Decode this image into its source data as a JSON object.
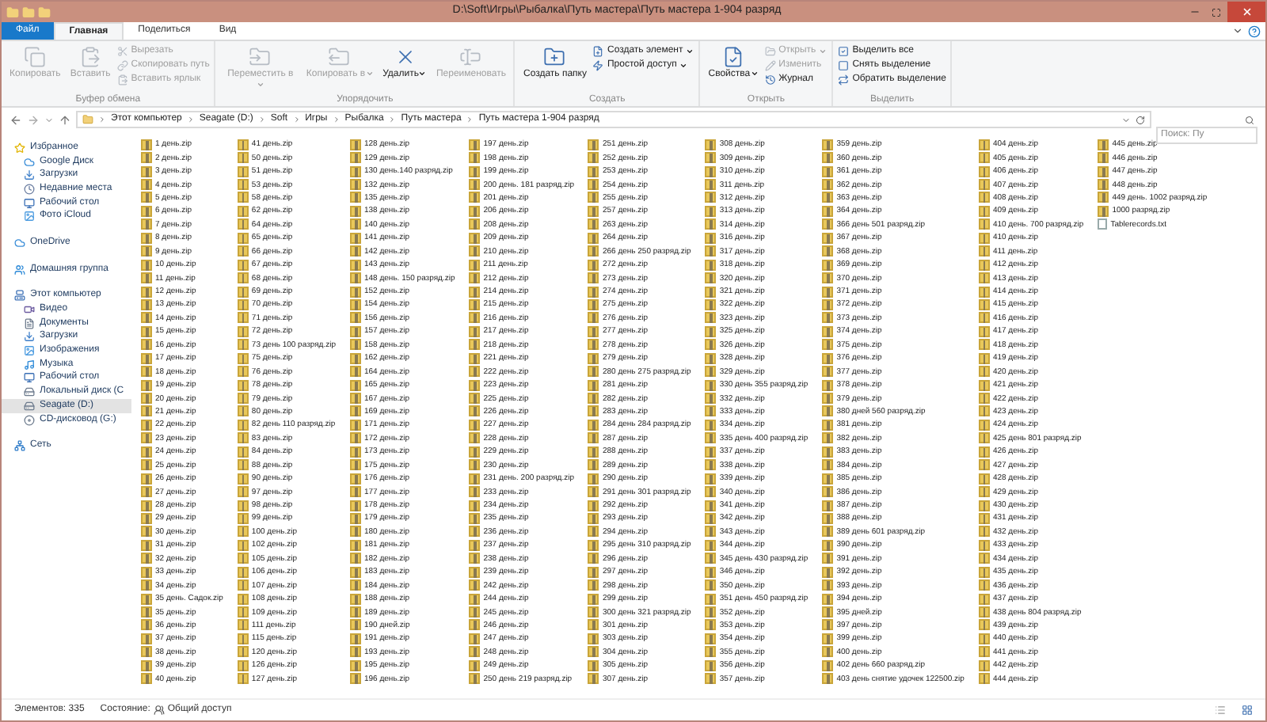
{
  "window": {
    "title": "D:\\Soft\\Игры\\Рыбалка\\Путь мастера\\Путь мастера 1-904 разряд"
  },
  "ribbon_tabs": [
    {
      "label": "Файл",
      "kind": "file",
      "selected": false
    },
    {
      "label": "Главная",
      "kind": "tab",
      "selected": true
    },
    {
      "label": "Поделиться",
      "kind": "tab",
      "selected": false
    },
    {
      "label": "Вид",
      "kind": "tab",
      "selected": false
    }
  ],
  "ribbon_groups": [
    {
      "label": "Буфер обмена",
      "buttons": [
        {
          "label": "Копировать",
          "kind": "large",
          "disabled": true,
          "menu": false
        },
        {
          "label": "Вставить",
          "kind": "large",
          "disabled": true,
          "menu": false
        },
        {
          "label": "Вырезать",
          "kind": "small",
          "disabled": true,
          "menu": false
        },
        {
          "label": "Скопировать путь",
          "kind": "small",
          "disabled": true,
          "menu": false
        },
        {
          "label": "Вставить ярлык",
          "kind": "small",
          "disabled": true,
          "menu": false
        }
      ]
    },
    {
      "label": "Упорядочить",
      "buttons": [
        {
          "label": "Переместить в",
          "kind": "large",
          "disabled": true,
          "menu": true
        },
        {
          "label": "Копировать в",
          "kind": "large",
          "disabled": true,
          "menu": true
        },
        {
          "label": "Удалить",
          "kind": "large",
          "disabled": false,
          "menu": true
        },
        {
          "label": "Переименовать",
          "kind": "large",
          "disabled": true,
          "menu": false
        }
      ]
    },
    {
      "label": "Создать",
      "buttons": [
        {
          "label": "Создать папку",
          "kind": "large",
          "disabled": false,
          "menu": false
        },
        {
          "label": "Создать элемент",
          "kind": "small",
          "disabled": false,
          "menu": true
        },
        {
          "label": "Простой доступ",
          "kind": "small",
          "disabled": false,
          "menu": true
        }
      ]
    },
    {
      "label": "Открыть",
      "buttons": [
        {
          "label": "Свойства",
          "kind": "large",
          "disabled": false,
          "menu": true
        },
        {
          "label": "Открыть",
          "kind": "small",
          "disabled": true,
          "menu": true
        },
        {
          "label": "Изменить",
          "kind": "small",
          "disabled": true,
          "menu": false
        },
        {
          "label": "Журнал",
          "kind": "small",
          "disabled": false,
          "menu": false
        }
      ]
    },
    {
      "label": "Выделить",
      "buttons": [
        {
          "label": "Выделить все",
          "kind": "small",
          "disabled": false,
          "menu": false
        },
        {
          "label": "Снять выделение",
          "kind": "small",
          "disabled": false,
          "menu": false
        },
        {
          "label": "Обратить выделение",
          "kind": "small",
          "disabled": false,
          "menu": false
        }
      ]
    }
  ],
  "address_bar": {
    "crumbs": [
      "Этот компьютер",
      "Seagate (D:)",
      "Soft",
      "Игры",
      "Рыбалка",
      "Путь мастера",
      "Путь мастера 1-904 разряд"
    ]
  },
  "search": {
    "placeholder": "Поиск: Пу"
  },
  "sidebar": [
    {
      "label": "Избранное",
      "selected": false,
      "children": [
        {
          "label": "Google Диск",
          "selected": false
        },
        {
          "label": "Загрузки",
          "selected": false
        },
        {
          "label": "Недавние места",
          "selected": false
        },
        {
          "label": "Рабочий стол",
          "selected": false
        },
        {
          "label": "Фото iCloud",
          "selected": false
        }
      ]
    },
    {
      "label": "OneDrive",
      "selected": false
    },
    {
      "label": "Домашняя группа",
      "selected": false
    },
    {
      "label": "Этот компьютер",
      "selected": false,
      "children": [
        {
          "label": "Видео",
          "selected": false
        },
        {
          "label": "Документы",
          "selected": false
        },
        {
          "label": "Загрузки",
          "selected": false
        },
        {
          "label": "Изображения",
          "selected": false
        },
        {
          "label": "Музыка",
          "selected": false
        },
        {
          "label": "Рабочий стол",
          "selected": false
        },
        {
          "label": "Локальный диск (C",
          "selected": false
        },
        {
          "label": "Seagate (D:)",
          "selected": true
        },
        {
          "label": "CD-дисковод (G:)",
          "selected": false
        }
      ]
    },
    {
      "label": "Сеть",
      "selected": false
    }
  ],
  "files": [
    {
      "name": "1 день.zip",
      "kind": "zip"
    },
    {
      "name": "2 день.zip",
      "kind": "zip"
    },
    {
      "name": "3 день.zip",
      "kind": "zip"
    },
    {
      "name": "4 день.zip",
      "kind": "zip"
    },
    {
      "name": "5 день.zip",
      "kind": "zip"
    },
    {
      "name": "6 день.zip",
      "kind": "zip"
    },
    {
      "name": "7 день.zip",
      "kind": "zip"
    },
    {
      "name": "8 день.zip",
      "kind": "zip"
    },
    {
      "name": "9 день.zip",
      "kind": "zip"
    },
    {
      "name": "10 день.zip",
      "kind": "zip"
    },
    {
      "name": "11 день.zip",
      "kind": "zip"
    },
    {
      "name": "12 день.zip",
      "kind": "zip"
    },
    {
      "name": "13 день.zip",
      "kind": "zip"
    },
    {
      "name": "14 день.zip",
      "kind": "zip"
    },
    {
      "name": "15 день.zip",
      "kind": "zip"
    },
    {
      "name": "16 день.zip",
      "kind": "zip"
    },
    {
      "name": "17 день.zip",
      "kind": "zip"
    },
    {
      "name": "18 день.zip",
      "kind": "zip"
    },
    {
      "name": "19 день.zip",
      "kind": "zip"
    },
    {
      "name": "20 день.zip",
      "kind": "zip"
    },
    {
      "name": "21 день.zip",
      "kind": "zip"
    },
    {
      "name": "22 день.zip",
      "kind": "zip"
    },
    {
      "name": "23 день.zip",
      "kind": "zip"
    },
    {
      "name": "24 день.zip",
      "kind": "zip"
    },
    {
      "name": "25 день.zip",
      "kind": "zip"
    },
    {
      "name": "26 день.zip",
      "kind": "zip"
    },
    {
      "name": "27 день.zip",
      "kind": "zip"
    },
    {
      "name": "28 день.zip",
      "kind": "zip"
    },
    {
      "name": "29 день.zip",
      "kind": "zip"
    },
    {
      "name": "30 день.zip",
      "kind": "zip"
    },
    {
      "name": "31 день.zip",
      "kind": "zip"
    },
    {
      "name": "32 день.zip",
      "kind": "zip"
    },
    {
      "name": "33 день.zip",
      "kind": "zip"
    },
    {
      "name": "34 день.zip",
      "kind": "zip"
    },
    {
      "name": "35 день. Садок.zip",
      "kind": "zip"
    },
    {
      "name": "35 день.zip",
      "kind": "zip"
    },
    {
      "name": "36 день.zip",
      "kind": "zip"
    },
    {
      "name": "37 день.zip",
      "kind": "zip"
    },
    {
      "name": "38 день.zip",
      "kind": "zip"
    },
    {
      "name": "39 день.zip",
      "kind": "zip"
    },
    {
      "name": "40 день.zip",
      "kind": "zip"
    },
    {
      "name": "41 день.zip",
      "kind": "zip"
    },
    {
      "name": "50 день.zip",
      "kind": "zip"
    },
    {
      "name": "51 день.zip",
      "kind": "zip"
    },
    {
      "name": "53 день.zip",
      "kind": "zip"
    },
    {
      "name": "58 день.zip",
      "kind": "zip"
    },
    {
      "name": "62 день.zip",
      "kind": "zip"
    },
    {
      "name": "64 день.zip",
      "kind": "zip"
    },
    {
      "name": "65 день.zip",
      "kind": "zip"
    },
    {
      "name": "66 день.zip",
      "kind": "zip"
    },
    {
      "name": "67 день.zip",
      "kind": "zip"
    },
    {
      "name": "68 день.zip",
      "kind": "zip"
    },
    {
      "name": "69 день.zip",
      "kind": "zip"
    },
    {
      "name": "70 день.zip",
      "kind": "zip"
    },
    {
      "name": "71 день.zip",
      "kind": "zip"
    },
    {
      "name": "72 день.zip",
      "kind": "zip"
    },
    {
      "name": "73 день 100 разряд.zip",
      "kind": "zip"
    },
    {
      "name": "75 день.zip",
      "kind": "zip"
    },
    {
      "name": "76 день.zip",
      "kind": "zip"
    },
    {
      "name": "78 день.zip",
      "kind": "zip"
    },
    {
      "name": "79 день.zip",
      "kind": "zip"
    },
    {
      "name": "80 день.zip",
      "kind": "zip"
    },
    {
      "name": "82 день 110 разряд.zip",
      "kind": "zip"
    },
    {
      "name": "83 день.zip",
      "kind": "zip"
    },
    {
      "name": "84 день.zip",
      "kind": "zip"
    },
    {
      "name": "88 день.zip",
      "kind": "zip"
    },
    {
      "name": "90 день.zip",
      "kind": "zip"
    },
    {
      "name": "97 день.zip",
      "kind": "zip"
    },
    {
      "name": "98 день.zip",
      "kind": "zip"
    },
    {
      "name": "99 день.zip",
      "kind": "zip"
    },
    {
      "name": "100 день.zip",
      "kind": "zip"
    },
    {
      "name": "102 день.zip",
      "kind": "zip"
    },
    {
      "name": "105 день.zip",
      "kind": "zip"
    },
    {
      "name": "106 день.zip",
      "kind": "zip"
    },
    {
      "name": "107 день.zip",
      "kind": "zip"
    },
    {
      "name": "108 день.zip",
      "kind": "zip"
    },
    {
      "name": "109 день.zip",
      "kind": "zip"
    },
    {
      "name": "111 день.zip",
      "kind": "zip"
    },
    {
      "name": "115 день.zip",
      "kind": "zip"
    },
    {
      "name": "120 день.zip",
      "kind": "zip"
    },
    {
      "name": "126 день.zip",
      "kind": "zip"
    },
    {
      "name": "127 день.zip",
      "kind": "zip"
    },
    {
      "name": "128 день.zip",
      "kind": "zip"
    },
    {
      "name": "129 день.zip",
      "kind": "zip"
    },
    {
      "name": "130 день.140 разряд.zip",
      "kind": "zip"
    },
    {
      "name": "132 день.zip",
      "kind": "zip"
    },
    {
      "name": "135 день.zip",
      "kind": "zip"
    },
    {
      "name": "138 день.zip",
      "kind": "zip"
    },
    {
      "name": "140 день.zip",
      "kind": "zip"
    },
    {
      "name": "141 день.zip",
      "kind": "zip"
    },
    {
      "name": "142 день.zip",
      "kind": "zip"
    },
    {
      "name": "143 день.zip",
      "kind": "zip"
    },
    {
      "name": "148 день. 150 разряд.zip",
      "kind": "zip"
    },
    {
      "name": "152 день.zip",
      "kind": "zip"
    },
    {
      "name": "154 день.zip",
      "kind": "zip"
    },
    {
      "name": "156 день.zip",
      "kind": "zip"
    },
    {
      "name": "157 день.zip",
      "kind": "zip"
    },
    {
      "name": "158 день.zip",
      "kind": "zip"
    },
    {
      "name": "162 день.zip",
      "kind": "zip"
    },
    {
      "name": "164 день.zip",
      "kind": "zip"
    },
    {
      "name": "165 день.zip",
      "kind": "zip"
    },
    {
      "name": "167 день.zip",
      "kind": "zip"
    },
    {
      "name": "169 день.zip",
      "kind": "zip"
    },
    {
      "name": "171 день.zip",
      "kind": "zip"
    },
    {
      "name": "172 день.zip",
      "kind": "zip"
    },
    {
      "name": "173 день.zip",
      "kind": "zip"
    },
    {
      "name": "175 день.zip",
      "kind": "zip"
    },
    {
      "name": "176 день.zip",
      "kind": "zip"
    },
    {
      "name": "177 день.zip",
      "kind": "zip"
    },
    {
      "name": "178 день.zip",
      "kind": "zip"
    },
    {
      "name": "179 день.zip",
      "kind": "zip"
    },
    {
      "name": "180 день.zip",
      "kind": "zip"
    },
    {
      "name": "181 день.zip",
      "kind": "zip"
    },
    {
      "name": "182 день.zip",
      "kind": "zip"
    },
    {
      "name": "183 день.zip",
      "kind": "zip"
    },
    {
      "name": "184 день.zip",
      "kind": "zip"
    },
    {
      "name": "188 день.zip",
      "kind": "zip"
    },
    {
      "name": "189 день.zip",
      "kind": "zip"
    },
    {
      "name": "190 дней.zip",
      "kind": "zip"
    },
    {
      "name": "191 день.zip",
      "kind": "zip"
    },
    {
      "name": "193 день.zip",
      "kind": "zip"
    },
    {
      "name": "195 день.zip",
      "kind": "zip"
    },
    {
      "name": "196 день.zip",
      "kind": "zip"
    },
    {
      "name": "197 день.zip",
      "kind": "zip"
    },
    {
      "name": "198 день.zip",
      "kind": "zip"
    },
    {
      "name": "199 день.zip",
      "kind": "zip"
    },
    {
      "name": "200 день. 181 разряд.zip",
      "kind": "zip"
    },
    {
      "name": "201 день.zip",
      "kind": "zip"
    },
    {
      "name": "206 день.zip",
      "kind": "zip"
    },
    {
      "name": "208 день.zip",
      "kind": "zip"
    },
    {
      "name": "209 день.zip",
      "kind": "zip"
    },
    {
      "name": "210 день.zip",
      "kind": "zip"
    },
    {
      "name": "211 день.zip",
      "kind": "zip"
    },
    {
      "name": "212 день.zip",
      "kind": "zip"
    },
    {
      "name": "214 день.zip",
      "kind": "zip"
    },
    {
      "name": "215 день.zip",
      "kind": "zip"
    },
    {
      "name": "216 день.zip",
      "kind": "zip"
    },
    {
      "name": "217 день.zip",
      "kind": "zip"
    },
    {
      "name": "218 день.zip",
      "kind": "zip"
    },
    {
      "name": "221 день.zip",
      "kind": "zip"
    },
    {
      "name": "222 день.zip",
      "kind": "zip"
    },
    {
      "name": "223 день.zip",
      "kind": "zip"
    },
    {
      "name": "225 день.zip",
      "kind": "zip"
    },
    {
      "name": "226 день.zip",
      "kind": "zip"
    },
    {
      "name": "227 день.zip",
      "kind": "zip"
    },
    {
      "name": "228 день.zip",
      "kind": "zip"
    },
    {
      "name": "229 день.zip",
      "kind": "zip"
    },
    {
      "name": "230 день.zip",
      "kind": "zip"
    },
    {
      "name": "231 день. 200 разряд.zip",
      "kind": "zip"
    },
    {
      "name": "233 день.zip",
      "kind": "zip"
    },
    {
      "name": "234 день.zip",
      "kind": "zip"
    },
    {
      "name": "235 день.zip",
      "kind": "zip"
    },
    {
      "name": "236 день.zip",
      "kind": "zip"
    },
    {
      "name": "237 день.zip",
      "kind": "zip"
    },
    {
      "name": "238 день.zip",
      "kind": "zip"
    },
    {
      "name": "239 день.zip",
      "kind": "zip"
    },
    {
      "name": "242 день.zip",
      "kind": "zip"
    },
    {
      "name": "244 день.zip",
      "kind": "zip"
    },
    {
      "name": "245 день.zip",
      "kind": "zip"
    },
    {
      "name": "246 день.zip",
      "kind": "zip"
    },
    {
      "name": "247 день.zip",
      "kind": "zip"
    },
    {
      "name": "248 день.zip",
      "kind": "zip"
    },
    {
      "name": "249 день.zip",
      "kind": "zip"
    },
    {
      "name": "250 день 219 разряд.zip",
      "kind": "zip"
    },
    {
      "name": "251 день.zip",
      "kind": "zip"
    },
    {
      "name": "252 день.zip",
      "kind": "zip"
    },
    {
      "name": "253 день.zip",
      "kind": "zip"
    },
    {
      "name": "254 день.zip",
      "kind": "zip"
    },
    {
      "name": "255 день.zip",
      "kind": "zip"
    },
    {
      "name": "257 день.zip",
      "kind": "zip"
    },
    {
      "name": "263 день.zip",
      "kind": "zip"
    },
    {
      "name": "264 день.zip",
      "kind": "zip"
    },
    {
      "name": "266 день 250 разряд.zip",
      "kind": "zip"
    },
    {
      "name": "272 день.zip",
      "kind": "zip"
    },
    {
      "name": "273 день.zip",
      "kind": "zip"
    },
    {
      "name": "274 день.zip",
      "kind": "zip"
    },
    {
      "name": "275 день.zip",
      "kind": "zip"
    },
    {
      "name": "276 день.zip",
      "kind": "zip"
    },
    {
      "name": "277 день.zip",
      "kind": "zip"
    },
    {
      "name": "278 день.zip",
      "kind": "zip"
    },
    {
      "name": "279 день.zip",
      "kind": "zip"
    },
    {
      "name": "280 день 275 разряд.zip",
      "kind": "zip"
    },
    {
      "name": "281 день.zip",
      "kind": "zip"
    },
    {
      "name": "282 день.zip",
      "kind": "zip"
    },
    {
      "name": "283 день.zip",
      "kind": "zip"
    },
    {
      "name": "284 день 284 разряд.zip",
      "kind": "zip"
    },
    {
      "name": "287 день.zip",
      "kind": "zip"
    },
    {
      "name": "288 день.zip",
      "kind": "zip"
    },
    {
      "name": "289 день.zip",
      "kind": "zip"
    },
    {
      "name": "290 день.zip",
      "kind": "zip"
    },
    {
      "name": "291 день 301 разряд.zip",
      "kind": "zip"
    },
    {
      "name": "292 день.zip",
      "kind": "zip"
    },
    {
      "name": "293 день.zip",
      "kind": "zip"
    },
    {
      "name": "294 день.zip",
      "kind": "zip"
    },
    {
      "name": "295 день 310 разряд.zip",
      "kind": "zip"
    },
    {
      "name": "296 день.zip",
      "kind": "zip"
    },
    {
      "name": "297 день.zip",
      "kind": "zip"
    },
    {
      "name": "298 день.zip",
      "kind": "zip"
    },
    {
      "name": "299 день.zip",
      "kind": "zip"
    },
    {
      "name": "300 день 321 разряд.zip",
      "kind": "zip"
    },
    {
      "name": "301 день.zip",
      "kind": "zip"
    },
    {
      "name": "303 день.zip",
      "kind": "zip"
    },
    {
      "name": "304 день.zip",
      "kind": "zip"
    },
    {
      "name": "305 день.zip",
      "kind": "zip"
    },
    {
      "name": "307 день.zip",
      "kind": "zip"
    },
    {
      "name": "308 день.zip",
      "kind": "zip"
    },
    {
      "name": "309 день.zip",
      "kind": "zip"
    },
    {
      "name": "310 день.zip",
      "kind": "zip"
    },
    {
      "name": "311 день.zip",
      "kind": "zip"
    },
    {
      "name": "312 день.zip",
      "kind": "zip"
    },
    {
      "name": "313 день.zip",
      "kind": "zip"
    },
    {
      "name": "314 день.zip",
      "kind": "zip"
    },
    {
      "name": "316 день.zip",
      "kind": "zip"
    },
    {
      "name": "317 день.zip",
      "kind": "zip"
    },
    {
      "name": "318 день.zip",
      "kind": "zip"
    },
    {
      "name": "320 день.zip",
      "kind": "zip"
    },
    {
      "name": "321 день.zip",
      "kind": "zip"
    },
    {
      "name": "322 день.zip",
      "kind": "zip"
    },
    {
      "name": "323 день.zip",
      "kind": "zip"
    },
    {
      "name": "325 день.zip",
      "kind": "zip"
    },
    {
      "name": "326 день.zip",
      "kind": "zip"
    },
    {
      "name": "328 день.zip",
      "kind": "zip"
    },
    {
      "name": "329 день.zip",
      "kind": "zip"
    },
    {
      "name": "330 день 355 разряд.zip",
      "kind": "zip"
    },
    {
      "name": "332 день.zip",
      "kind": "zip"
    },
    {
      "name": "333 день.zip",
      "kind": "zip"
    },
    {
      "name": "334 день.zip",
      "kind": "zip"
    },
    {
      "name": "335 день 400 разряд.zip",
      "kind": "zip"
    },
    {
      "name": "337 день.zip",
      "kind": "zip"
    },
    {
      "name": "338 день.zip",
      "kind": "zip"
    },
    {
      "name": "339 день.zip",
      "kind": "zip"
    },
    {
      "name": "340 день.zip",
      "kind": "zip"
    },
    {
      "name": "341 день.zip",
      "kind": "zip"
    },
    {
      "name": "342 день.zip",
      "kind": "zip"
    },
    {
      "name": "343 день.zip",
      "kind": "zip"
    },
    {
      "name": "344 день.zip",
      "kind": "zip"
    },
    {
      "name": "345 день 430 разряд.zip",
      "kind": "zip"
    },
    {
      "name": "346 день.zip",
      "kind": "zip"
    },
    {
      "name": "350 день.zip",
      "kind": "zip"
    },
    {
      "name": "351 день 450 разряд.zip",
      "kind": "zip"
    },
    {
      "name": "352 день.zip",
      "kind": "zip"
    },
    {
      "name": "353 день.zip",
      "kind": "zip"
    },
    {
      "name": "354 день.zip",
      "kind": "zip"
    },
    {
      "name": "355 день.zip",
      "kind": "zip"
    },
    {
      "name": "356 день.zip",
      "kind": "zip"
    },
    {
      "name": "357 день.zip",
      "kind": "zip"
    },
    {
      "name": "359 день.zip",
      "kind": "zip"
    },
    {
      "name": "360 день.zip",
      "kind": "zip"
    },
    {
      "name": "361 день.zip",
      "kind": "zip"
    },
    {
      "name": "362 день.zip",
      "kind": "zip"
    },
    {
      "name": "363 день.zip",
      "kind": "zip"
    },
    {
      "name": "364 день.zip",
      "kind": "zip"
    },
    {
      "name": "366 день 501 разряд.zip",
      "kind": "zip"
    },
    {
      "name": "367 день.zip",
      "kind": "zip"
    },
    {
      "name": "368 день.zip",
      "kind": "zip"
    },
    {
      "name": "369 день.zip",
      "kind": "zip"
    },
    {
      "name": "370 день.zip",
      "kind": "zip"
    },
    {
      "name": "371 день.zip",
      "kind": "zip"
    },
    {
      "name": "372 день.zip",
      "kind": "zip"
    },
    {
      "name": "373 день.zip",
      "kind": "zip"
    },
    {
      "name": "374 день.zip",
      "kind": "zip"
    },
    {
      "name": "375 день.zip",
      "kind": "zip"
    },
    {
      "name": "376 день.zip",
      "kind": "zip"
    },
    {
      "name": "377 день.zip",
      "kind": "zip"
    },
    {
      "name": "378 день.zip",
      "kind": "zip"
    },
    {
      "name": "379 день.zip",
      "kind": "zip"
    },
    {
      "name": "380 дней 560 разряд.zip",
      "kind": "zip"
    },
    {
      "name": "381 день.zip",
      "kind": "zip"
    },
    {
      "name": "382 день.zip",
      "kind": "zip"
    },
    {
      "name": "383 день.zip",
      "kind": "zip"
    },
    {
      "name": "384 день.zip",
      "kind": "zip"
    },
    {
      "name": "385 день.zip",
      "kind": "zip"
    },
    {
      "name": "386 день.zip",
      "kind": "zip"
    },
    {
      "name": "387 день.zip",
      "kind": "zip"
    },
    {
      "name": "388 день.zip",
      "kind": "zip"
    },
    {
      "name": "389 день 601 разряд.zip",
      "kind": "zip"
    },
    {
      "name": "390 день.zip",
      "kind": "zip"
    },
    {
      "name": "391 день.zip",
      "kind": "zip"
    },
    {
      "name": "392 день.zip",
      "kind": "zip"
    },
    {
      "name": "393 день.zip",
      "kind": "zip"
    },
    {
      "name": "394 день.zip",
      "kind": "zip"
    },
    {
      "name": "395 дней.zip",
      "kind": "zip"
    },
    {
      "name": "397 день.zip",
      "kind": "zip"
    },
    {
      "name": "399 день.zip",
      "kind": "zip"
    },
    {
      "name": "400 день.zip",
      "kind": "zip"
    },
    {
      "name": "402 день 660 разряд.zip",
      "kind": "zip"
    },
    {
      "name": "403 день снятие удочек 122500.zip",
      "kind": "zip"
    },
    {
      "name": "404 день.zip",
      "kind": "zip"
    },
    {
      "name": "405 день.zip",
      "kind": "zip"
    },
    {
      "name": "406 день.zip",
      "kind": "zip"
    },
    {
      "name": "407 день.zip",
      "kind": "zip"
    },
    {
      "name": "408 день.zip",
      "kind": "zip"
    },
    {
      "name": "409 день.zip",
      "kind": "zip"
    },
    {
      "name": "410 день. 700 разряд.zip",
      "kind": "zip"
    },
    {
      "name": "410 день.zip",
      "kind": "zip"
    },
    {
      "name": "411 день.zip",
      "kind": "zip"
    },
    {
      "name": "412 день.zip",
      "kind": "zip"
    },
    {
      "name": "413 день.zip",
      "kind": "zip"
    },
    {
      "name": "414 день.zip",
      "kind": "zip"
    },
    {
      "name": "415 день.zip",
      "kind": "zip"
    },
    {
      "name": "416 день.zip",
      "kind": "zip"
    },
    {
      "name": "417 день.zip",
      "kind": "zip"
    },
    {
      "name": "418 день.zip",
      "kind": "zip"
    },
    {
      "name": "419 день.zip",
      "kind": "zip"
    },
    {
      "name": "420 день.zip",
      "kind": "zip"
    },
    {
      "name": "421 день.zip",
      "kind": "zip"
    },
    {
      "name": "422 день.zip",
      "kind": "zip"
    },
    {
      "name": "423 день.zip",
      "kind": "zip"
    },
    {
      "name": "424 день.zip",
      "kind": "zip"
    },
    {
      "name": "425 день 801 разряд.zip",
      "kind": "zip"
    },
    {
      "name": "426 день.zip",
      "kind": "zip"
    },
    {
      "name": "427 день.zip",
      "kind": "zip"
    },
    {
      "name": "428 день.zip",
      "kind": "zip"
    },
    {
      "name": "429 день.zip",
      "kind": "zip"
    },
    {
      "name": "430 день.zip",
      "kind": "zip"
    },
    {
      "name": "431 день.zip",
      "kind": "zip"
    },
    {
      "name": "432 день.zip",
      "kind": "zip"
    },
    {
      "name": "433 день.zip",
      "kind": "zip"
    },
    {
      "name": "434 день.zip",
      "kind": "zip"
    },
    {
      "name": "435 день.zip",
      "kind": "zip"
    },
    {
      "name": "436 день.zip",
      "kind": "zip"
    },
    {
      "name": "437 день.zip",
      "kind": "zip"
    },
    {
      "name": "438 день 804 разряд.zip",
      "kind": "zip"
    },
    {
      "name": "439 день.zip",
      "kind": "zip"
    },
    {
      "name": "440 день.zip",
      "kind": "zip"
    },
    {
      "name": "441 день.zip",
      "kind": "zip"
    },
    {
      "name": "442 день.zip",
      "kind": "zip"
    },
    {
      "name": "444 день.zip",
      "kind": "zip"
    },
    {
      "name": "445 день.zip",
      "kind": "zip"
    },
    {
      "name": "446 день.zip",
      "kind": "zip"
    },
    {
      "name": "447 день.zip",
      "kind": "zip"
    },
    {
      "name": "448 день.zip",
      "kind": "zip"
    },
    {
      "name": "449 день. 1002 разряд.zip",
      "kind": "zip"
    },
    {
      "name": "1000 разряд.zip",
      "kind": "zip"
    },
    {
      "name": "Tablerecords.txt",
      "kind": "txt"
    }
  ],
  "status_bar": {
    "count": "Элементов: 335",
    "state_label": "Состояние:",
    "share": "Общий доступ"
  }
}
